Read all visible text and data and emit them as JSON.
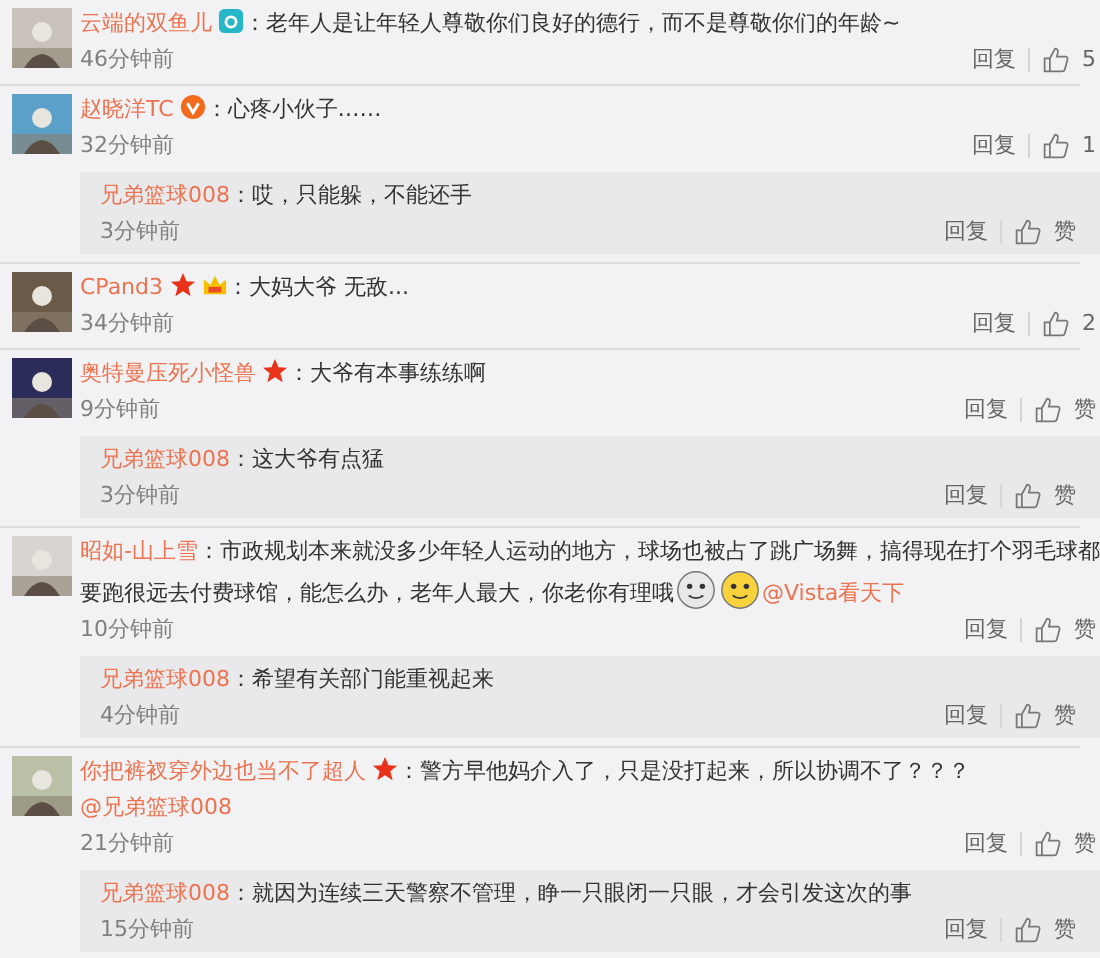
{
  "comments": [
    {
      "author": "云端的双鱼儿",
      "badges": [
        {
          "kind": "camera"
        }
      ],
      "content": [
        {
          "kind": "text",
          "text": "：老年人是让年轻人尊敬你们良好的德行，而不是尊敬你们的年龄~"
        }
      ],
      "time": "46分钟前",
      "reply_label": "回复",
      "like_label": "5"
    },
    {
      "author": "赵晓洋TC",
      "badges": [
        {
          "kind": "vip"
        }
      ],
      "content": [
        {
          "kind": "text",
          "text": "：心疼小伙子……"
        }
      ],
      "time": "32分钟前",
      "reply_label": "回复",
      "like_label": "1",
      "replies": [
        {
          "author": "兄弟篮球008",
          "content": [
            {
              "kind": "text",
              "text": "：哎，只能躲，不能还手"
            }
          ],
          "time": "3分钟前",
          "reply_label": "回复",
          "like_label": "赞"
        }
      ]
    },
    {
      "author": "CPand3",
      "badges": [
        {
          "kind": "star"
        },
        {
          "kind": "crown"
        }
      ],
      "content": [
        {
          "kind": "text",
          "text": "：大妈大爷 无敌..."
        }
      ],
      "time": "34分钟前",
      "reply_label": "回复",
      "like_label": "2"
    },
    {
      "author": "奥特曼压死小怪兽",
      "badges": [
        {
          "kind": "star"
        }
      ],
      "content": [
        {
          "kind": "text",
          "text": "：大爷有本事练练啊"
        }
      ],
      "time": "9分钟前",
      "reply_label": "回复",
      "like_label": "赞",
      "replies": [
        {
          "author": "兄弟篮球008",
          "content": [
            {
              "kind": "text",
              "text": "：这大爷有点猛"
            }
          ],
          "time": "3分钟前",
          "reply_label": "回复",
          "like_label": "赞"
        }
      ]
    },
    {
      "author": "昭如-山上雪",
      "content": [
        {
          "kind": "text",
          "text": "：市政规划本来就没多少年轻人运动的地方，球场也被占了跳广场舞，搞得现在打个羽毛球都要跑很远去付费球馆，能怎么办，老年人最大，你老你有理哦"
        },
        {
          "kind": "emoji"
        },
        {
          "kind": "emoji"
        },
        {
          "kind": "mention",
          "text": "@Vista看天下"
        }
      ],
      "time": "10分钟前",
      "reply_label": "回复",
      "like_label": "赞",
      "replies": [
        {
          "author": "兄弟篮球008",
          "content": [
            {
              "kind": "text",
              "text": "：希望有关部门能重视起来"
            }
          ],
          "time": "4分钟前",
          "reply_label": "回复",
          "like_label": "赞"
        }
      ]
    },
    {
      "author": "你把裤衩穿外边也当不了超人",
      "badges": [
        {
          "kind": "star"
        }
      ],
      "content": [
        {
          "kind": "text",
          "text": "：警方早他妈介入了，只是没打起来，所以协调不了？？？"
        },
        {
          "kind": "mention",
          "text": "@兄弟篮球008"
        }
      ],
      "time": "21分钟前",
      "reply_label": "回复",
      "like_label": "赞",
      "replies": [
        {
          "author": "兄弟篮球008",
          "content": [
            {
              "kind": "text",
              "text": "：就因为连续三天警察不管理，睁一只眼闭一只眼，才会引发这次的事"
            }
          ],
          "time": "15分钟前",
          "reply_label": "回复",
          "like_label": "赞"
        }
      ]
    }
  ]
}
